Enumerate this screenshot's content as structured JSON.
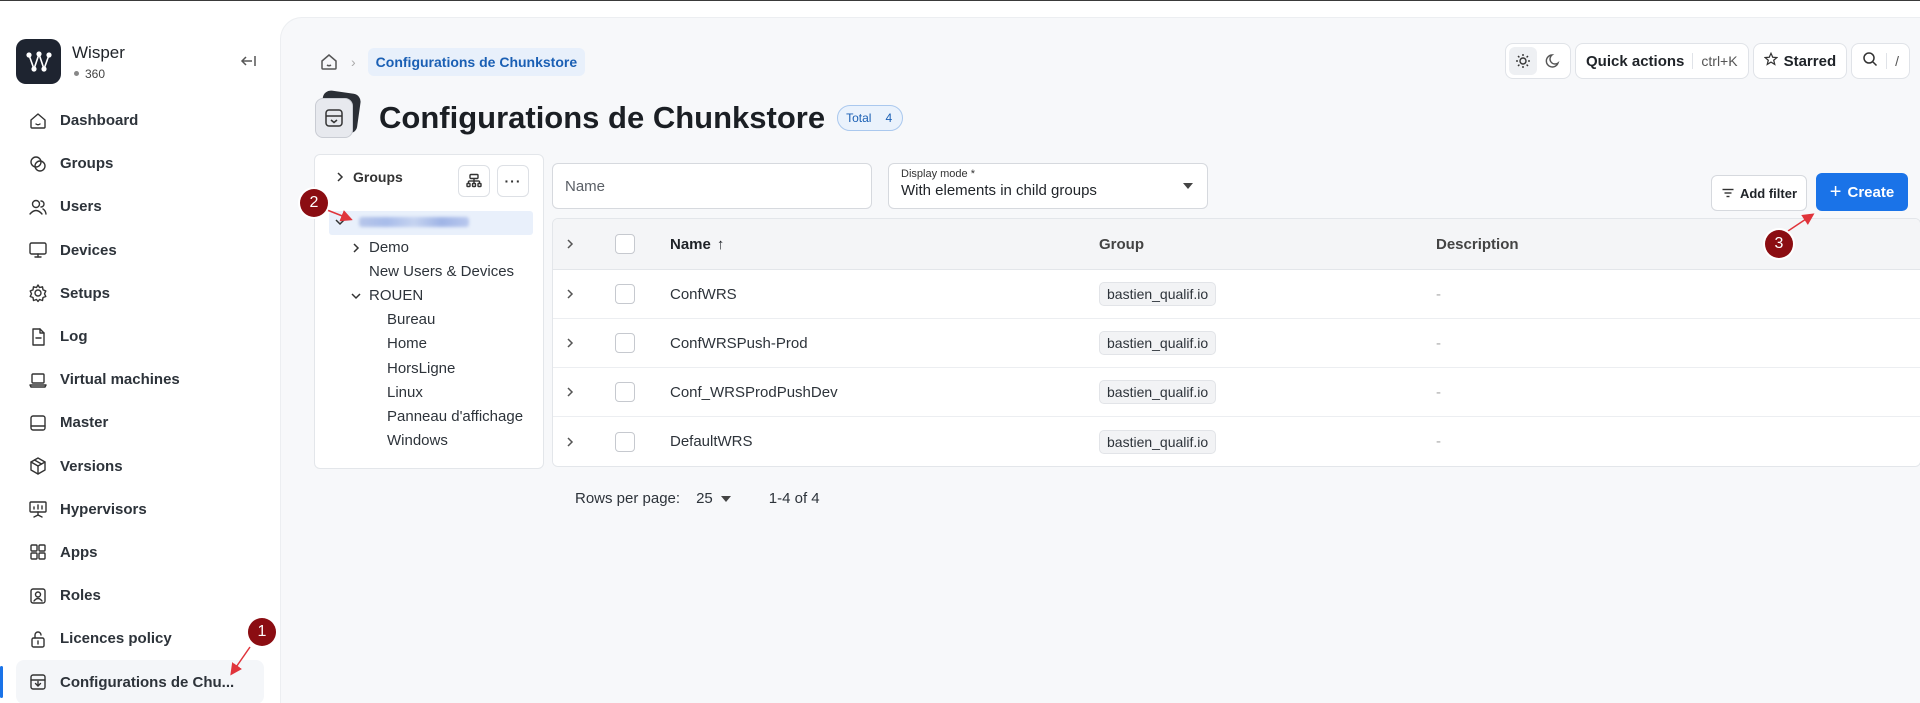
{
  "app": {
    "name": "Wisper",
    "count": "360"
  },
  "sidebar": {
    "items": [
      {
        "label": "Dashboard",
        "icon": "home-icon"
      },
      {
        "label": "Groups",
        "icon": "groups-icon"
      },
      {
        "label": "Users",
        "icon": "users-icon"
      },
      {
        "label": "Devices",
        "icon": "monitor-icon"
      },
      {
        "label": "Setups",
        "icon": "gear-icon"
      },
      {
        "label": "Log",
        "icon": "log-icon"
      },
      {
        "label": "Virtual machines",
        "icon": "laptop-icon"
      },
      {
        "label": "Master",
        "icon": "master-icon"
      },
      {
        "label": "Versions",
        "icon": "package-icon"
      },
      {
        "label": "Hypervisors",
        "icon": "presentation-icon"
      },
      {
        "label": "Apps",
        "icon": "apps-grid-icon"
      },
      {
        "label": "Roles",
        "icon": "id-badge-icon"
      },
      {
        "label": "Licences policy",
        "icon": "lock-icon"
      },
      {
        "label": "Configurations de Chu...",
        "icon": "archive-icon",
        "active": true
      }
    ]
  },
  "breadcrumb": {
    "current": "Configurations de Chunkstore"
  },
  "toolbar": {
    "quick_actions": "Quick actions",
    "shortcut": "ctrl+K",
    "starred": "Starred",
    "search_shortcut": "/"
  },
  "page": {
    "title": "Configurations de Chunkstore",
    "total_label": "Total",
    "total_value": "4"
  },
  "tree": {
    "header": "Groups",
    "items": [
      {
        "label": "Demo",
        "level": 1,
        "expander": "collapsed"
      },
      {
        "label": "New Users & Devices",
        "level": 1,
        "expander": "none"
      },
      {
        "label": "ROUEN",
        "level": 1,
        "expander": "expanded"
      },
      {
        "label": "Bureau",
        "level": 2
      },
      {
        "label": "Home",
        "level": 2
      },
      {
        "label": "HorsLigne",
        "level": 2
      },
      {
        "label": "Linux",
        "level": 2
      },
      {
        "label": "Panneau d'affichage",
        "level": 2
      },
      {
        "label": "Windows",
        "level": 2
      }
    ]
  },
  "filters": {
    "name_placeholder": "Name",
    "display_mode_label": "Display mode *",
    "display_mode_value": "With elements in child groups",
    "add_filter": "Add filter",
    "create": "Create"
  },
  "table": {
    "columns": [
      "Name",
      "Group",
      "Description"
    ],
    "sort_indicator": "↑",
    "rows": [
      {
        "name": "ConfWRS",
        "group": "bastien_qualif.io",
        "description": "-"
      },
      {
        "name": "ConfWRSPush-Prod",
        "group": "bastien_qualif.io",
        "description": "-"
      },
      {
        "name": "Conf_WRSProdPushDev",
        "group": "bastien_qualif.io",
        "description": "-"
      },
      {
        "name": "DefaultWRS",
        "group": "bastien_qualif.io",
        "description": "-"
      }
    ]
  },
  "pagination": {
    "rows_per_page_label": "Rows per page:",
    "rows_per_page": "25",
    "range": "1-4 of 4"
  },
  "annotations": [
    "1",
    "2",
    "3"
  ],
  "colors": {
    "accent": "#1a73e8",
    "marker": "#8b0d12",
    "arrow": "#e0343b"
  }
}
